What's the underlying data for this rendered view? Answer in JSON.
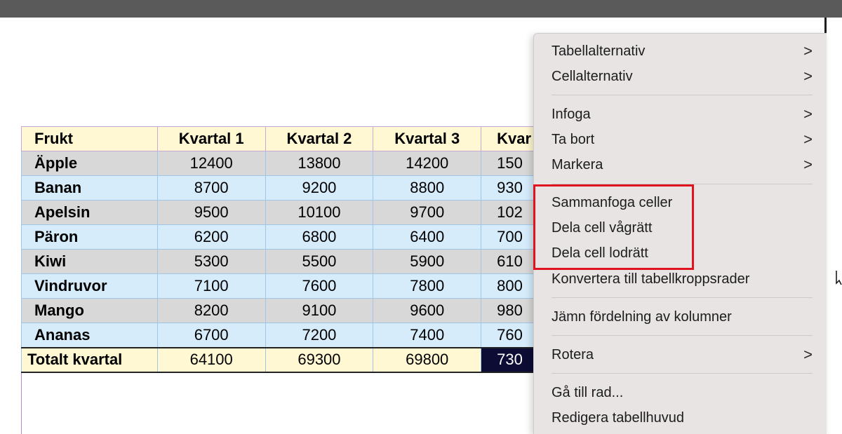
{
  "table": {
    "headers": [
      "Frukt",
      "Kvartal 1",
      "Kvartal 2",
      "Kvartal 3",
      "Kvar"
    ],
    "rows": [
      {
        "name": "Äpple",
        "v": [
          "12400",
          "13800",
          "14200",
          "150"
        ]
      },
      {
        "name": "Banan",
        "v": [
          "8700",
          "9200",
          "8800",
          "930"
        ]
      },
      {
        "name": "Apelsin",
        "v": [
          "9500",
          "10100",
          "9700",
          "102"
        ]
      },
      {
        "name": "Päron",
        "v": [
          "6200",
          "6800",
          "6400",
          "700"
        ]
      },
      {
        "name": "Kiwi",
        "v": [
          "5300",
          "5500",
          "5900",
          "610"
        ]
      },
      {
        "name": "Vindruvor",
        "v": [
          "7100",
          "7600",
          "7800",
          "800"
        ]
      },
      {
        "name": "Mango",
        "v": [
          "8200",
          "9100",
          "9600",
          "980"
        ]
      },
      {
        "name": "Ananas",
        "v": [
          "6700",
          "7200",
          "7400",
          "760"
        ]
      }
    ],
    "total": {
      "name": "Totalt kvartal",
      "v": [
        "64100",
        "69300",
        "69800",
        "730"
      ]
    }
  },
  "menu": {
    "items": [
      {
        "label": "Tabellalternativ",
        "submenu": true
      },
      {
        "label": "Cellalternativ",
        "submenu": true
      },
      {
        "label": "Infoga",
        "submenu": true
      },
      {
        "label": "Ta bort",
        "submenu": true
      },
      {
        "label": "Markera",
        "submenu": true
      },
      {
        "label": "Sammanfoga celler",
        "submenu": false
      },
      {
        "label": "Dela cell vågrätt",
        "submenu": false
      },
      {
        "label": "Dela cell lodrätt",
        "submenu": false
      },
      {
        "label": "Konvertera till tabellkroppsrader",
        "submenu": false
      },
      {
        "label": "Jämn fördelning av kolumner",
        "submenu": false
      },
      {
        "label": "Rotera",
        "submenu": true
      },
      {
        "label": "Gå till rad...",
        "submenu": false
      },
      {
        "label": "Redigera tabellhuvud",
        "submenu": false
      }
    ],
    "chevron": ">"
  },
  "colors": {
    "highlight": "#e0141e",
    "selected_cell": "#0c0c35",
    "header_bg": "#fff8d2"
  }
}
